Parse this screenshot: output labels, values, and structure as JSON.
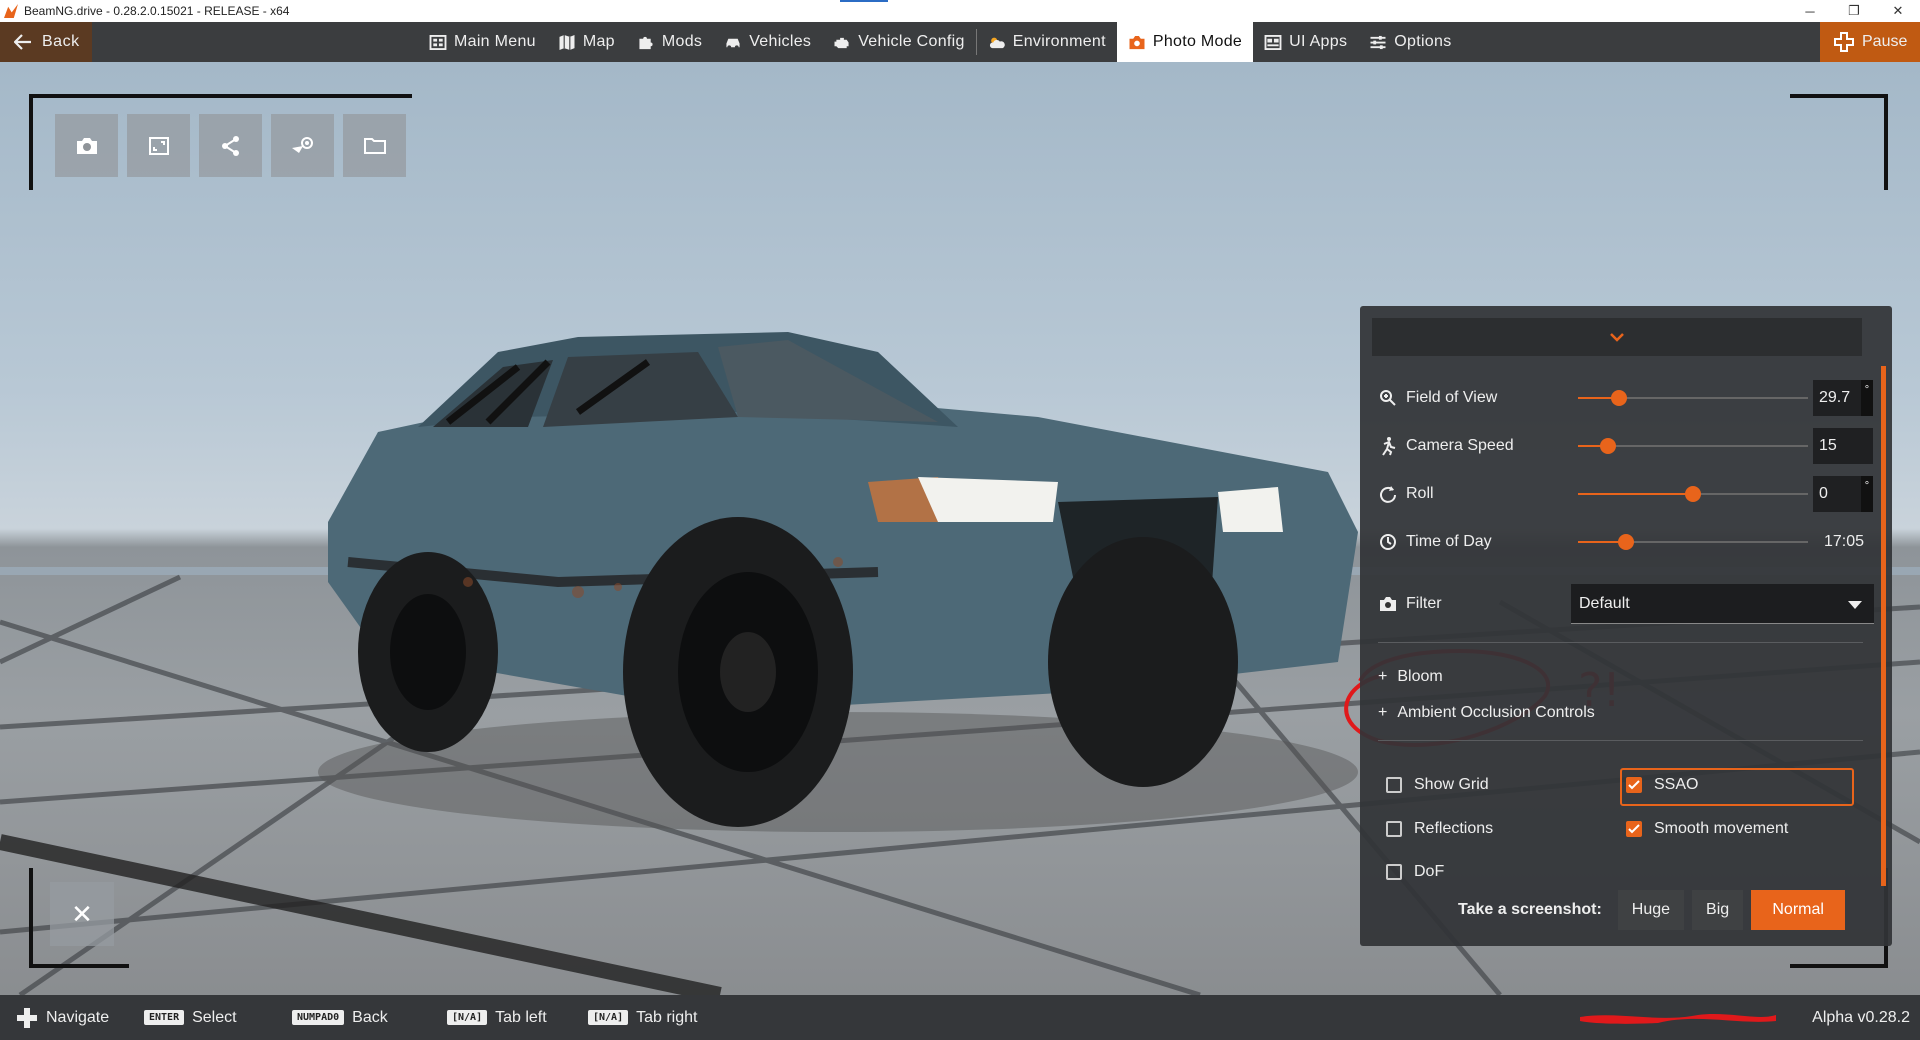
{
  "window": {
    "title": "BeamNG.drive - 0.28.2.0.15021 - RELEASE - x64",
    "minimize": "─",
    "restore": "❐",
    "close": "✕"
  },
  "topbar": {
    "back_label": "Back",
    "pause_label": "Pause",
    "menu": [
      {
        "label": "Main Menu",
        "icon": "main-menu-icon"
      },
      {
        "label": "Map",
        "icon": "map-icon"
      },
      {
        "label": "Mods",
        "icon": "puzzle-icon"
      },
      {
        "label": "Vehicles",
        "icon": "car-icon"
      },
      {
        "label": "Vehicle Config",
        "icon": "engine-icon"
      },
      {
        "label": "Environment",
        "icon": "weather-icon"
      },
      {
        "label": "Photo Mode",
        "icon": "camera-icon",
        "active": true
      },
      {
        "label": "UI Apps",
        "icon": "ui-apps-icon"
      },
      {
        "label": "Options",
        "icon": "sliders-icon"
      }
    ],
    "accent_color": "#e8641b"
  },
  "tools": [
    {
      "icon": "camera-icon"
    },
    {
      "icon": "fullscreen-icon"
    },
    {
      "icon": "share-icon"
    },
    {
      "icon": "steam-icon"
    },
    {
      "icon": "folder-icon"
    }
  ],
  "close_label": "✕",
  "panel": {
    "collapse_icon": "chevron-down-icon",
    "field_of_view": {
      "label": "Field of View",
      "value": "29.7",
      "unit": "°",
      "level": 0.18
    },
    "camera_speed": {
      "label": "Camera Speed",
      "value": "15",
      "level": 0.13
    },
    "roll": {
      "label": "Roll",
      "value": "0",
      "unit": "°",
      "level": 0.5
    },
    "time_of_day": {
      "label": "Time of Day",
      "value": "17:05",
      "level": 0.21
    },
    "filter": {
      "label": "Filter",
      "value": "Default"
    },
    "expanders": [
      {
        "sign": "+",
        "label": "Bloom"
      },
      {
        "sign": "+",
        "label": "Ambient Occlusion Controls"
      }
    ],
    "checks": {
      "show_grid": {
        "label": "Show Grid",
        "checked": false
      },
      "ssao": {
        "label": "SSAO",
        "checked": true
      },
      "reflections": {
        "label": "Reflections",
        "checked": false
      },
      "smooth_movement": {
        "label": "Smooth movement",
        "checked": true
      },
      "dof": {
        "label": "DoF",
        "checked": false
      }
    },
    "screenshot": {
      "label": "Take a screenshot:",
      "huge": "Huge",
      "big": "Big",
      "normal": "Normal"
    }
  },
  "annotation_text": "?!",
  "bottombar": {
    "hints": [
      {
        "key": "",
        "label": "Navigate"
      },
      {
        "key": "ENTER",
        "label": "Select"
      },
      {
        "key": "NUMPAD0",
        "label": "Back"
      },
      {
        "key": "[N/A]",
        "label": "Tab left"
      },
      {
        "key": "[N/A]",
        "label": "Tab right"
      }
    ],
    "version": "Alpha v0.28.2"
  }
}
